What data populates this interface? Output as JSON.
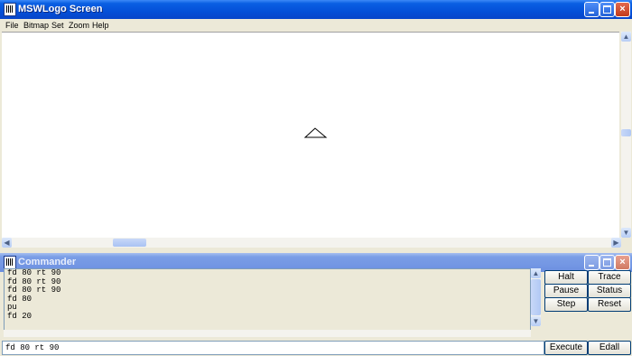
{
  "screen_window": {
    "title": "MSWLogo Screen",
    "menu": [
      "File",
      "Bitmap",
      "Set",
      "Zoom",
      "Help"
    ],
    "titlebar_buttons": {
      "minimize": "_",
      "maximize": "□",
      "close": "×"
    }
  },
  "commander": {
    "title": "Commander",
    "history": [
      "fd 80 rt 90",
      "fd 80 rt 90",
      "fd 80 rt 90",
      "fd 80",
      "pu",
      "fd 20"
    ],
    "input_value": "fd 80 rt 90",
    "buttons": {
      "halt": "Halt",
      "trace": "Trace",
      "pause": "Pause",
      "status": "Status",
      "step": "Step",
      "reset": "Reset",
      "execute": "Execute",
      "edall": "Edall"
    }
  },
  "colors": {
    "active_titlebar": "#0450d8",
    "inactive_titlebar": "#7295e3",
    "close_button": "#c23a1a",
    "window_background": "#ece9d8"
  },
  "icons": [
    "logo-app-icon",
    "minimize-icon",
    "maximize-icon",
    "close-icon",
    "turtle-icon",
    "scroll-arrow-icon"
  ]
}
